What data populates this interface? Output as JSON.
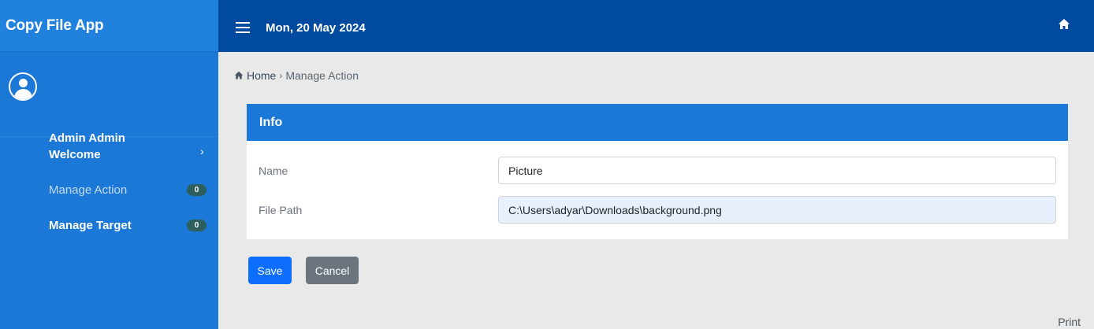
{
  "app": {
    "title": "Copy File App"
  },
  "user": {
    "name": "Admin Admin"
  },
  "sidebar": {
    "items": [
      {
        "label": "Welcome"
      },
      {
        "label": "Manage Action",
        "badge": "0"
      },
      {
        "label": "Manage Target",
        "badge": "0"
      }
    ]
  },
  "topbar": {
    "date": "Mon, 20 May 2024"
  },
  "breadcrumb": {
    "home": "Home",
    "current": "Manage Action"
  },
  "card": {
    "title": "Info",
    "fields": [
      {
        "label": "Name",
        "value": "Picture"
      },
      {
        "label": "File Path",
        "value": "C:\\Users\\adyar\\Downloads\\background.png"
      }
    ]
  },
  "actions": {
    "save": "Save",
    "cancel": "Cancel"
  },
  "footer": {
    "print": "Print"
  },
  "colors": {
    "sidebar": "#1c78d6",
    "topbar": "#004a9f",
    "primary": "#0d6efd",
    "secondary": "#6c757d",
    "badge": "#2e5f5f"
  },
  "icons": {
    "menu": "hamburger-icon",
    "home": "home-icon",
    "user": "user-circle-icon",
    "chevron": "chevron-right-icon"
  }
}
